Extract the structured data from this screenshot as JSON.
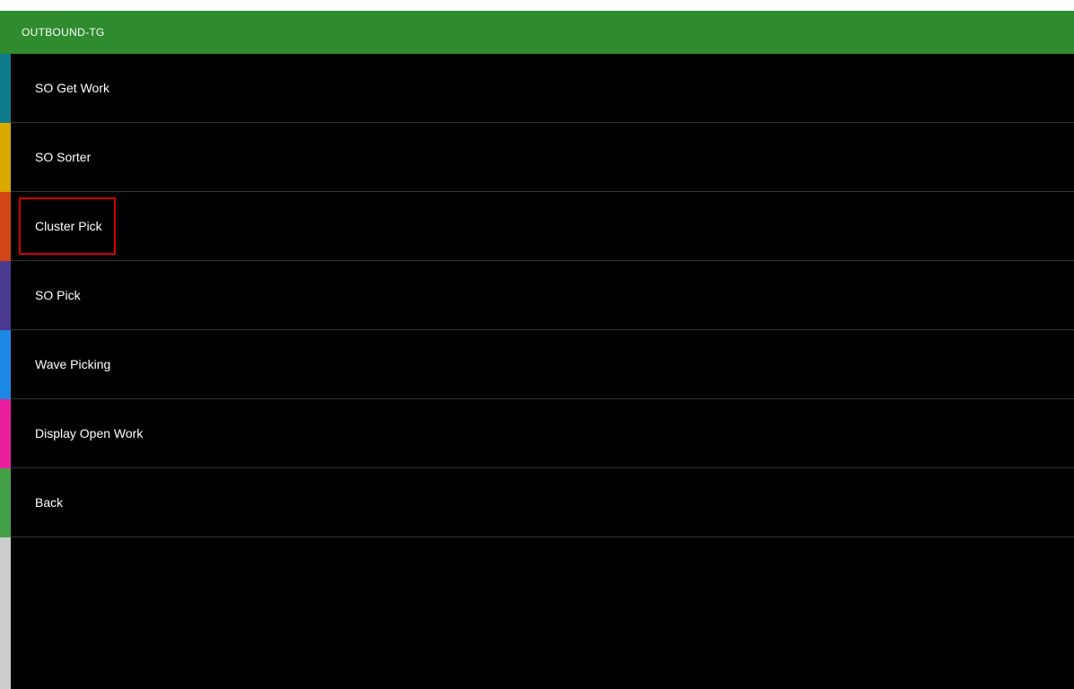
{
  "header": {
    "title": "OUTBOUND-TG"
  },
  "menu": {
    "items": [
      {
        "label": "SO Get Work",
        "highlighted": false
      },
      {
        "label": "SO Sorter",
        "highlighted": false
      },
      {
        "label": "Cluster Pick",
        "highlighted": true
      },
      {
        "label": "SO Pick",
        "highlighted": false
      },
      {
        "label": "Wave Picking",
        "highlighted": false
      },
      {
        "label": "Display Open Work",
        "highlighted": false
      },
      {
        "label": "Back",
        "highlighted": false
      }
    ]
  },
  "sidebar_colors": [
    "#2e8b2e",
    "#0f7a8c",
    "#d9a900",
    "#d24615",
    "#4a3a8f",
    "#1e88e5",
    "#e91e9d",
    "#43a047"
  ]
}
